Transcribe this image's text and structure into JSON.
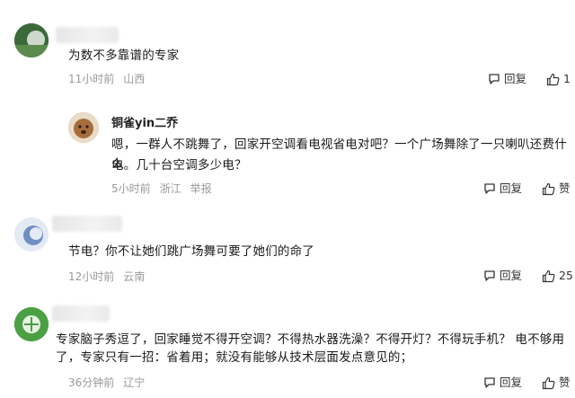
{
  "comments": [
    {
      "text": "为数不多靠谱的专家",
      "time": "11小时前",
      "location": "山西",
      "reply_label": "回复",
      "like_label": "1"
    },
    {
      "author": "铜雀yin二乔",
      "text_line1": "嗯，一群人不跳舞了，回家开空调看电视省电对吧？一个广场舞除了一只喇叭还费什么",
      "text_line2": "电。几十台空调多少电？",
      "time": "5小时前",
      "location": "浙江",
      "report_label": "举报",
      "reply_label": "回复",
      "like_label": "赞"
    },
    {
      "text": "节电？你不让她们跳广场舞可要了她们的命了",
      "time": "12小时前",
      "location": "云南",
      "reply_label": "回复",
      "like_label": "25"
    },
    {
      "text_line1": "专家脑子秀逗了，回家睡觉不得开空调？不得热水器洗澡？不得开灯？不得玩手机？ 电不够用",
      "text_line2": "了，专家只有一招：省着用；就没有能够从技术层面发点意见的；",
      "time": "36分钟前",
      "location": "辽宁",
      "reply_label": "回复",
      "like_label": "赞"
    }
  ],
  "icons": {
    "reply": "comment-icon",
    "like": "thumbs-up-icon"
  },
  "colors": {
    "meta": "#999999",
    "text": "#1a1a1a"
  }
}
